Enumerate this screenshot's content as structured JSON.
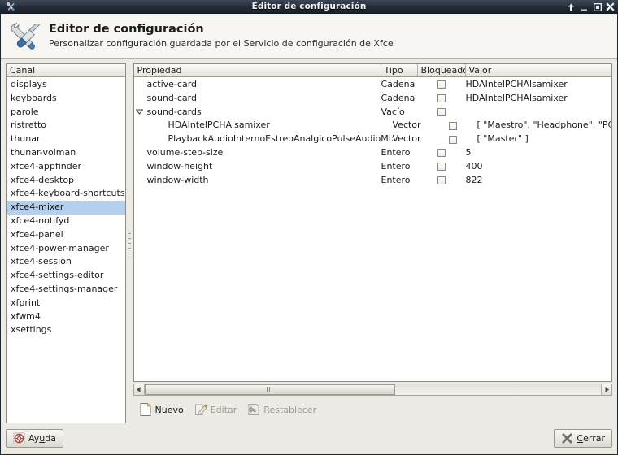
{
  "window": {
    "title": "Editor de configuración",
    "icon": "tools-icon",
    "controls": [
      {
        "name": "shade-above-button",
        "glyph": "up-arrow-icon"
      },
      {
        "name": "minimize-button",
        "glyph": "minimize-icon"
      },
      {
        "name": "maximize-button",
        "glyph": "maximize-icon"
      },
      {
        "name": "close-button",
        "glyph": "close-icon"
      }
    ]
  },
  "banner": {
    "icon": "tools-icon",
    "title": "Editor de configuración",
    "subtitle": "Personalizar configuración guardada por el Servicio de configuración de Xfce"
  },
  "channels": {
    "header": "Canal",
    "selected": "xfce4-mixer",
    "items": [
      "displays",
      "keyboards",
      "parole",
      "ristretto",
      "thunar",
      "thunar-volman",
      "xfce4-appfinder",
      "xfce4-desktop",
      "xfce4-keyboard-shortcuts",
      "xfce4-mixer",
      "xfce4-notifyd",
      "xfce4-panel",
      "xfce4-power-manager",
      "xfce4-session",
      "xfce4-settings-editor",
      "xfce4-settings-manager",
      "xfprint",
      "xfwm4",
      "xsettings"
    ]
  },
  "properties": {
    "columns": [
      "Propiedad",
      "Tipo",
      "Bloqueado",
      "Valor"
    ],
    "rows": [
      {
        "name": "active-card",
        "type": "Cadena",
        "locked": false,
        "value": "HDAIntelPCHAlsamixer",
        "indent": 0,
        "expander": "none"
      },
      {
        "name": "sound-card",
        "type": "Cadena",
        "locked": false,
        "value": "HDAIntelPCHAlsamixer",
        "indent": 0,
        "expander": "none"
      },
      {
        "name": "sound-cards",
        "type": "Vacío",
        "locked": false,
        "value": "",
        "indent": 0,
        "expander": "expanded"
      },
      {
        "name": "HDAIntelPCHAlsamixer",
        "type": "Vector",
        "locked": false,
        "value": "[ \"Maestro\", \"Headphone\", \"PCM\", \"I",
        "indent": 1,
        "expander": "none"
      },
      {
        "name": "PlaybackAudioInternoEstreoAnalgicoPulseAudioMixer",
        "type": "Vector",
        "locked": false,
        "value": "[ \"Master\" ]",
        "indent": 1,
        "expander": "none"
      },
      {
        "name": "volume-step-size",
        "type": "Entero",
        "locked": false,
        "value": "5",
        "indent": 0,
        "expander": "none"
      },
      {
        "name": "window-height",
        "type": "Entero",
        "locked": false,
        "value": "400",
        "indent": 0,
        "expander": "none"
      },
      {
        "name": "window-width",
        "type": "Entero",
        "locked": false,
        "value": "822",
        "indent": 0,
        "expander": "none"
      }
    ]
  },
  "scrollbar": {
    "thumb_percent": 55
  },
  "actions": [
    {
      "name": "new-button",
      "label_pre": "",
      "label_accel": "N",
      "label_post": "uevo",
      "icon": "new-document-icon",
      "enabled": true
    },
    {
      "name": "edit-button",
      "label_pre": "",
      "label_accel": "E",
      "label_post": "ditar",
      "icon": "edit-pencil-icon",
      "enabled": false
    },
    {
      "name": "reset-button",
      "label_pre": "",
      "label_accel": "R",
      "label_post": "establecer",
      "icon": "reset-undo-icon",
      "enabled": false
    }
  ],
  "footer": {
    "help": {
      "label_pre": "Ay",
      "label_accel": "u",
      "label_post": "da",
      "icon": "help-lifering-icon"
    },
    "close": {
      "label_pre": "",
      "label_accel": "C",
      "label_post": "errar",
      "icon": "close-x-icon"
    }
  },
  "colors": {
    "titlebar": "#2b3441",
    "selection": "#b4d0ec",
    "client_bg": "#eceae4",
    "list_bg": "#ffffff"
  }
}
